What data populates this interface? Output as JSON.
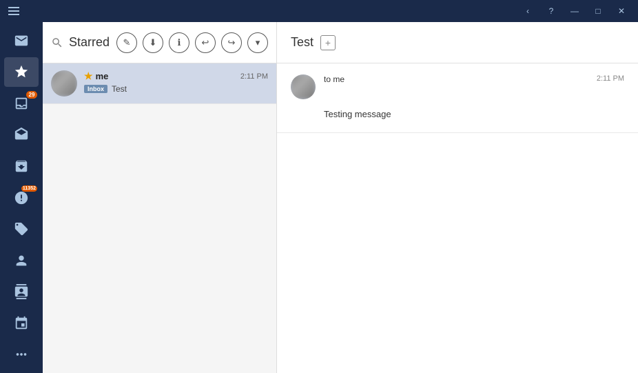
{
  "titlebar": {
    "back_label": "‹",
    "help_label": "?",
    "minimize_label": "—",
    "maximize_label": "□",
    "close_label": "✕"
  },
  "sidebar": {
    "items": [
      {
        "id": "mail",
        "label": "Mail",
        "icon": "mail-icon",
        "badge": null
      },
      {
        "id": "starred",
        "label": "Starred",
        "icon": "star-icon",
        "badge": null,
        "active": true
      },
      {
        "id": "inbox",
        "label": "Inbox",
        "icon": "inbox-icon",
        "badge": "29"
      },
      {
        "id": "drafts",
        "label": "Drafts",
        "icon": "drafts-icon",
        "badge": null
      },
      {
        "id": "archive",
        "label": "Archive",
        "icon": "archive-icon",
        "badge": null
      },
      {
        "id": "spam",
        "label": "Spam",
        "icon": "spam-icon",
        "badge": "11352"
      },
      {
        "id": "tags",
        "label": "Tags",
        "icon": "tags-icon",
        "badge": null
      }
    ],
    "bottom_items": [
      {
        "id": "contacts",
        "label": "Contacts",
        "icon": "contacts-icon"
      },
      {
        "id": "address-book",
        "label": "Address Book",
        "icon": "address-book-icon"
      },
      {
        "id": "calendar",
        "label": "Calendar",
        "icon": "calendar-icon"
      },
      {
        "id": "more",
        "label": "More",
        "icon": "more-icon"
      }
    ]
  },
  "email_list": {
    "section_title": "Starred",
    "toolbar_buttons": [
      {
        "id": "compose",
        "label": "✎"
      },
      {
        "id": "download",
        "label": "⬇"
      },
      {
        "id": "info",
        "label": "ℹ"
      },
      {
        "id": "reply",
        "label": "↩"
      },
      {
        "id": "forward",
        "label": "↪"
      },
      {
        "id": "more",
        "label": "▾"
      }
    ],
    "emails": [
      {
        "id": "email-1",
        "sender": "me",
        "starred": true,
        "time": "2:11 PM",
        "label": "Inbox",
        "subject": "Test",
        "selected": true
      }
    ]
  },
  "reading_pane": {
    "title": "Test",
    "messages": [
      {
        "id": "msg-1",
        "to": "to me",
        "time": "2:11 PM",
        "body": "Testing message"
      }
    ]
  }
}
